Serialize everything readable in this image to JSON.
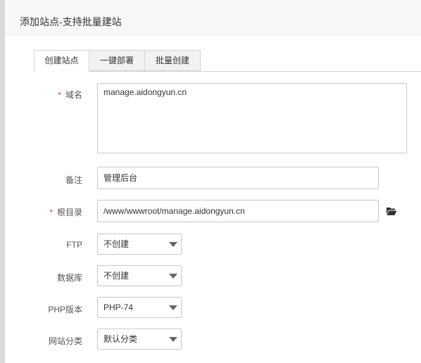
{
  "dialog": {
    "title": "添加站点-支持批量建站"
  },
  "tabs": [
    {
      "label": "创建站点",
      "active": true
    },
    {
      "label": "一键部署",
      "active": false
    },
    {
      "label": "批量创建",
      "active": false
    }
  ],
  "form": {
    "domain": {
      "required": "*",
      "label": "域名",
      "value": "manage.aidongyun.cn"
    },
    "remark": {
      "label": "备注",
      "value": "管理后台"
    },
    "root": {
      "required": "*",
      "label": "根目录",
      "value": "/www/wwwroot/manage.aidongyun.cn",
      "browse_icon": "folder-open-icon"
    },
    "ftp": {
      "label": "FTP",
      "selected": "不创建"
    },
    "database": {
      "label": "数据库",
      "selected": "不创建"
    },
    "php": {
      "label": "PHP版本",
      "selected": "PHP-74"
    },
    "category": {
      "label": "网站分类",
      "selected": "默认分类"
    }
  },
  "colors": {
    "required": "#e4393c",
    "border": "#c8c8c8",
    "header_bg": "#f8f8f8"
  }
}
